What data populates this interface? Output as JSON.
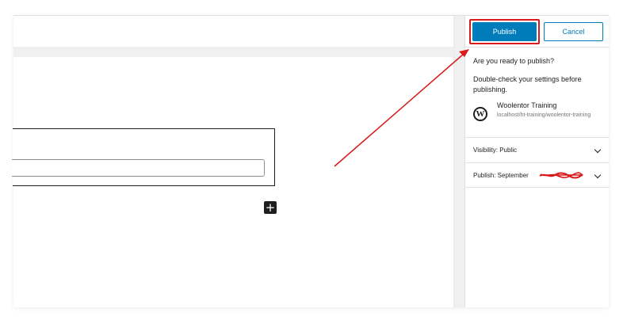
{
  "sidebar": {
    "publish_label": "Publish",
    "cancel_label": "Cancel",
    "title": "Are you ready to publish?",
    "description": "Double-check your settings before publishing.",
    "site": {
      "name": "Woolentor Training",
      "url": "localhost/ht-training/woolentor-training",
      "logo": "W"
    },
    "visibility_label": "Visibility: Public",
    "publish_date_label": "Publish: September"
  },
  "editor": {
    "inserter_icon": "+"
  },
  "colors": {
    "accent": "#007cba",
    "annotation": "#d81b1b"
  }
}
